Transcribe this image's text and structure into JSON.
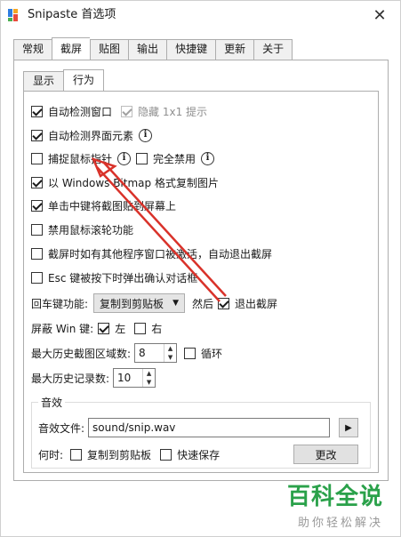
{
  "window": {
    "title": "Snipaste 首选项",
    "close_glyph": "✕"
  },
  "tabs": [
    {
      "label": "常规",
      "active": false
    },
    {
      "label": "截屏",
      "active": true
    },
    {
      "label": "贴图",
      "active": false
    },
    {
      "label": "输出",
      "active": false
    },
    {
      "label": "快捷键",
      "active": false
    },
    {
      "label": "更新",
      "active": false
    },
    {
      "label": "关于",
      "active": false
    }
  ],
  "subtabs": [
    {
      "label": "显示",
      "active": false
    },
    {
      "label": "行为",
      "active": true
    }
  ],
  "options": {
    "auto_detect_window": {
      "label": "自动检测窗口",
      "checked": true
    },
    "hide_1x1_hint": {
      "label": "隐藏 1x1 提示",
      "checked": true,
      "disabled": true
    },
    "auto_detect_ui": {
      "label": "自动检测界面元素",
      "checked": true
    },
    "capture_cursor": {
      "label": "捕捉鼠标指针",
      "checked": false
    },
    "disable_completely": {
      "label": "完全禁用",
      "checked": false
    },
    "copy_as_bitmap": {
      "label": "以 Windows Bitmap 格式复制图片",
      "checked": true
    },
    "middle_click_paste": {
      "label": "单击中键将截图贴到屏幕上",
      "checked": true
    },
    "disable_scroll": {
      "label": "禁用鼠标滚轮功能",
      "checked": false
    },
    "auto_exit": {
      "label": "截屏时如有其他程序窗口被激活，自动退出截屏",
      "checked": false
    },
    "esc_confirm": {
      "label": "Esc 键被按下时弹出确认对话框",
      "checked": false
    }
  },
  "enter_key": {
    "label": "回车键功能:",
    "select_value": "复制到剪贴板",
    "then_label": "然后",
    "exit_label": "退出截屏",
    "exit_checked": true
  },
  "win_key": {
    "label": "屏蔽 Win 键:",
    "left_label": "左",
    "left_checked": true,
    "right_label": "右",
    "right_checked": false
  },
  "history_area": {
    "label": "最大历史截图区域数:",
    "value": "8",
    "loop_label": "循环",
    "loop_checked": false
  },
  "history_records": {
    "label": "最大历史记录数:",
    "value": "10"
  },
  "sound": {
    "group_label": "音效",
    "file_label": "音效文件:",
    "file_value": "sound/snip.wav",
    "when_label": "何时:",
    "copy_label": "复制到剪贴板",
    "copy_checked": false,
    "quicksave_label": "快速保存",
    "quicksave_checked": false,
    "change_button": "更改"
  },
  "watermark": {
    "title": "百科全说",
    "subtitle": "助你轻松解决"
  },
  "colors": {
    "accent_green": "#2aa14a",
    "annotation_red": "#d9322a"
  }
}
